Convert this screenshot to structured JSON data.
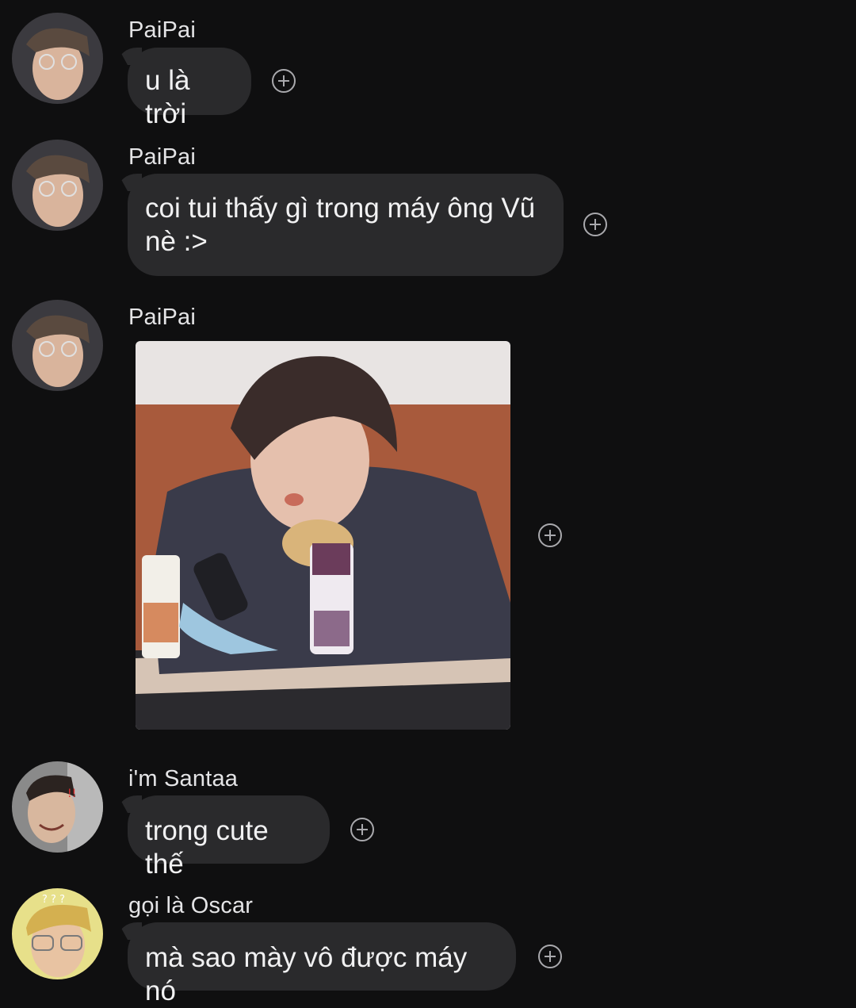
{
  "messages": [
    {
      "sender": "PaiPai",
      "text": "u là trời"
    },
    {
      "sender": "PaiPai",
      "text_line1": "coi tui thấy gì trong máy ông Vũ",
      "text_line2": "nè :>"
    },
    {
      "sender": "PaiPai",
      "image": "photo-of-person-eating-with-phone"
    },
    {
      "sender": "i'm Santaa",
      "text": "trong cute thế"
    },
    {
      "sender": "gọi là Oscar",
      "text": "mà sao mày vô được máy nó"
    }
  ],
  "icons": {
    "reaction": "add-reaction-icon"
  },
  "colors": {
    "background": "#0f0f10",
    "bubble": "#2a2a2c",
    "text": "#f1f1f2",
    "icon": "#a9a9ad"
  }
}
